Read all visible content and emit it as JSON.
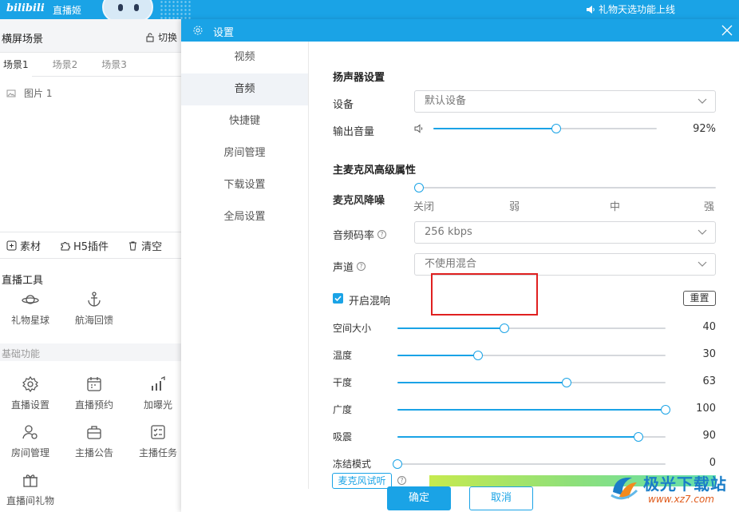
{
  "topbar": {
    "logo_text": "bilibili",
    "app_name": "直播姬",
    "announcement": "礼物天选功能上线"
  },
  "left_panel": {
    "scene_title": "横屏场景",
    "switch_label": "切换",
    "scene_tabs": [
      "场景1",
      "场景2",
      "场景3"
    ],
    "source_item": "图片 1",
    "toolbar": {
      "material": "素材",
      "h5_plugin": "H5插件",
      "clear": "清空"
    },
    "live_tools_title": "直播工具",
    "live_tools": [
      {
        "label": "礼物星球",
        "icon": "planet-icon"
      },
      {
        "label": "航海回馈",
        "icon": "anchor-icon"
      }
    ],
    "basic_title": "基础功能",
    "basic_tools": [
      {
        "label": "直播设置",
        "icon": "gear-icon"
      },
      {
        "label": "直播预约",
        "icon": "calendar-icon"
      },
      {
        "label": "加曝光",
        "icon": "bar-chart-icon"
      },
      {
        "label": "房间管理",
        "icon": "user-gear-icon"
      },
      {
        "label": "主播公告",
        "icon": "briefcase-icon"
      },
      {
        "label": "主播任务",
        "icon": "checklist-icon"
      },
      {
        "label": "直播间礼物",
        "icon": "gift-icon"
      }
    ]
  },
  "modal": {
    "title": "设置",
    "nav": [
      "视频",
      "音频",
      "快捷键",
      "房间管理",
      "下载设置",
      "全局设置"
    ],
    "active_nav": "音频",
    "speaker_section": "扬声器设置",
    "device_label": "设备",
    "device_value": "默认设备",
    "output_volume_label": "输出音量",
    "output_volume_value": "92%",
    "output_volume_level": 0.55,
    "mic_section": "主麦克风高级属性",
    "noise_label": "麦克风降噪",
    "noise_ticks": [
      "关闭",
      "弱",
      "中",
      "强"
    ],
    "bitrate_label": "音频码率",
    "bitrate_value": "256 kbps",
    "channel_label": "声道",
    "channel_value": "不使用混合",
    "reverb_label": "开启混响",
    "reverb_checked": true,
    "reset_label": "重置",
    "reverb_sliders": [
      {
        "label": "空间大小",
        "value": "40",
        "level": 0.4
      },
      {
        "label": "温度",
        "value": "30",
        "level": 0.3
      },
      {
        "label": "干度",
        "value": "63",
        "level": 0.63
      },
      {
        "label": "广度",
        "value": "100",
        "level": 1.0
      },
      {
        "label": "吸震",
        "value": "90",
        "level": 0.9
      },
      {
        "label": "冻结模式",
        "value": "0",
        "level": 0.0
      }
    ],
    "mic_test_label": "麦克风试听",
    "ok_label": "确定",
    "cancel_label": "取消"
  },
  "watermark": {
    "title": "极光下载站",
    "url": "www.xz7.com"
  },
  "colors": {
    "accent": "#1aa3e6",
    "highlight_box": "#e02020"
  }
}
